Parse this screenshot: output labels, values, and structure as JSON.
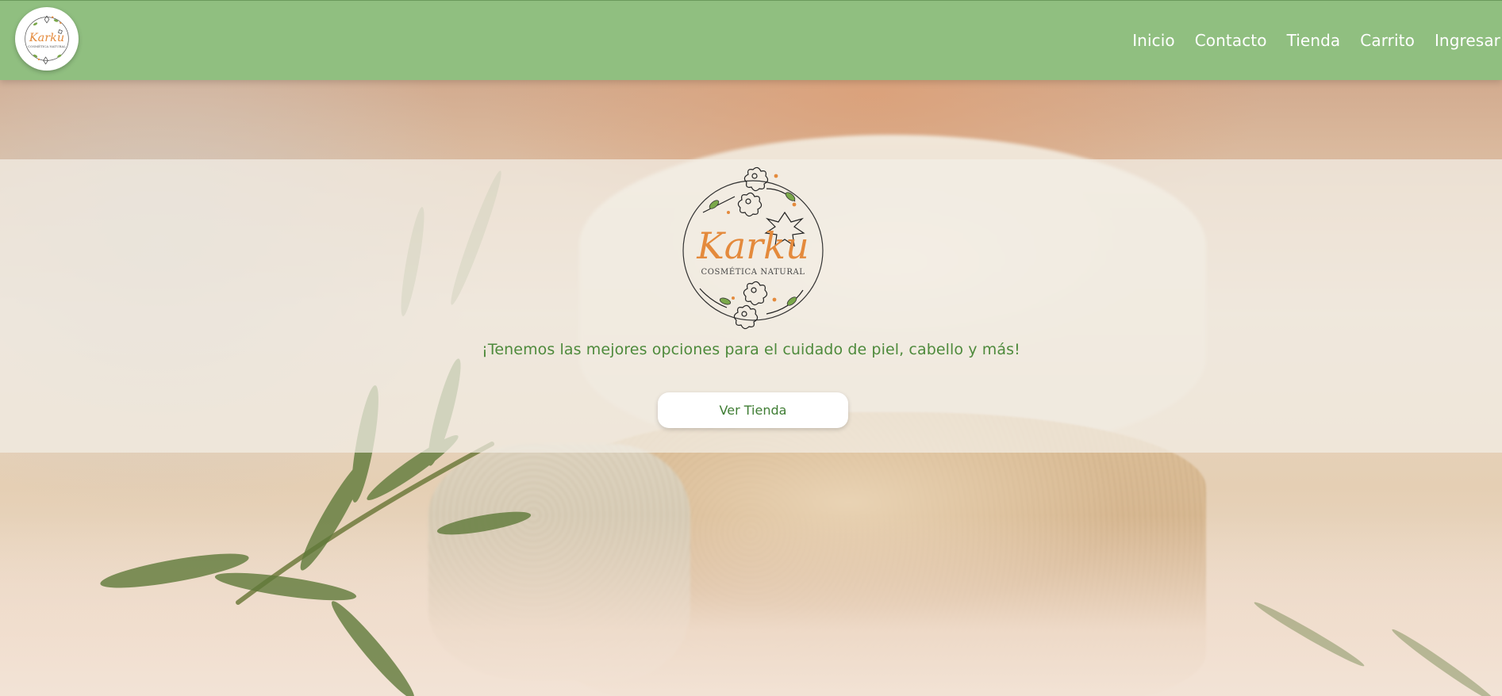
{
  "header": {
    "background_color": "#90bf80",
    "logo": {
      "alt": "Karku Cosmética Natural logo",
      "brand_name": "Karku",
      "brand_subtitle": "COSMÉTICA NATURAL"
    },
    "nav": [
      {
        "label": "Inicio"
      },
      {
        "label": "Contacto"
      },
      {
        "label": "Tienda"
      },
      {
        "label": "Carrito"
      },
      {
        "label": "Ingresar"
      }
    ]
  },
  "hero": {
    "logo": {
      "brand_name": "Karku",
      "brand_subtitle": "COSMÉTICA NATURAL",
      "brand_color": "#e48a3c"
    },
    "tagline": "¡Tenemos las mejores opciones para el cuidado de piel, cabello y más!",
    "tagline_color": "#4e8a3c",
    "cta_label": "Ver Tienda"
  }
}
